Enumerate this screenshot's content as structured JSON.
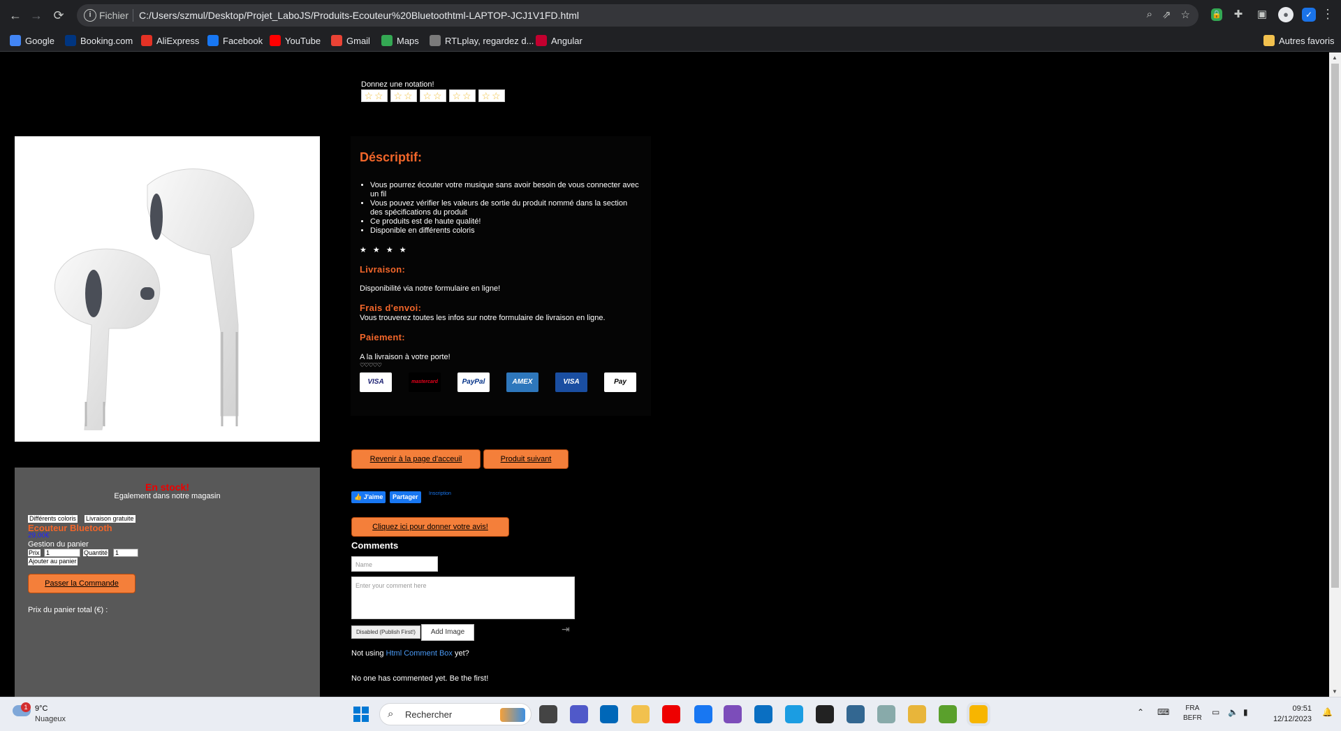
{
  "browser": {
    "scheme_label": "Fichier",
    "url": "C:/Users/szmul/Desktop/Projet_LaboJS/Produits-Ecouteur%20Bluetoothtml-LAPTOP-JCJ1V1FD.html",
    "bookmarks": [
      {
        "label": "Google",
        "icon": "google-icon",
        "color": "#4285f4"
      },
      {
        "label": "Booking.com",
        "icon": "booking-icon",
        "color": "#003580"
      },
      {
        "label": "AliExpress",
        "icon": "aliexpress-icon",
        "color": "#e43225"
      },
      {
        "label": "Facebook",
        "icon": "facebook-icon",
        "color": "#1877f2"
      },
      {
        "label": "YouTube",
        "icon": "youtube-icon",
        "color": "#ff0000"
      },
      {
        "label": "Gmail",
        "icon": "gmail-icon",
        "color": "#ea4335"
      },
      {
        "label": "Maps",
        "icon": "maps-icon",
        "color": "#34a853"
      },
      {
        "label": "RTLplay, regardez d...",
        "icon": "rtlplay-icon",
        "color": "#7a7a7a"
      },
      {
        "label": "Angular",
        "icon": "angular-icon",
        "color": "#c3002f"
      }
    ],
    "other_bookmarks": "Autres favoris"
  },
  "page": {
    "rating_prompt": "Donnez une notation!",
    "rating_stars": 5,
    "description": {
      "title": "Déscriptif:",
      "items": [
        "Vous pourrez écouter votre musique sans avoir besoin de vous connecter avec un fil",
        "Vous pouvez vérifier les valeurs de sortie du produit nommé dans la section des spécifications du produit",
        "Ce produits est de haute qualité!",
        "Disponible en différents coloris"
      ],
      "dots": "★ ★ ★ ★"
    },
    "livraison": {
      "title": "Livraison:",
      "text": "Disponibilité via notre formulaire en ligne!"
    },
    "frais": {
      "title": "Frais d'envoi:",
      "text": "Vous trouverez toutes les infos sur notre formulaire de livraison en ligne."
    },
    "paiement": {
      "title": "Paiement:",
      "text": "A la livraison à votre porte!",
      "hearts": "♡♡♡♡♡"
    },
    "cards": [
      {
        "label": "VISA",
        "bg": "#fff",
        "fg": "#1a1f71"
      },
      {
        "label": "mastercard",
        "bg": "#000",
        "fg": "#eb001b"
      },
      {
        "label": "PayPal",
        "bg": "#fff",
        "fg": "#003087"
      },
      {
        "label": "AMEX",
        "bg": "#2e77bc",
        "fg": "#fff"
      },
      {
        "label": "VISA",
        "bg": "#1a4ea1",
        "fg": "#fff"
      },
      {
        "label": "Pay",
        "bg": "#fff",
        "fg": "#000"
      }
    ],
    "buttons": {
      "home": "Revenir à la page d'acceuil",
      "next": "Produit suivant",
      "review": "Cliquez ici pour donner votre avis!",
      "order": "Passer la Commande"
    },
    "facebook": {
      "like": "J'aime",
      "share": "Partager",
      "text": "Inscription"
    },
    "stock": {
      "status": "En stock!",
      "store": "Egalement dans notre magasin",
      "tag1": "Différents coloris",
      "tag2": "Livraison gratuite",
      "name": "Ecouteur Bluetooth",
      "price": "29,00€",
      "cart_title": "Gestion du panier",
      "price_label": "Prix",
      "price_value": "1",
      "qty_label": "Quantité",
      "qty_value": "1",
      "add_cart": "Ajouter au panier",
      "total": "Prix du panier total (€) :"
    },
    "comments": {
      "title": "Comments",
      "name_placeholder": "Name",
      "comment_placeholder": "Enter your comment here",
      "disabled_btn": "Disabled (Publish First!)",
      "add_image": "Add Image",
      "not_using_pre": "Not using",
      "not_using_link": "Html Comment Box",
      "not_using_post": "yet?",
      "no_one": "No one has commented yet. Be the first!"
    }
  },
  "taskbar": {
    "weather_temp": "9°C",
    "weather_cond": "Nuageux",
    "weather_badge": "1",
    "search": "Rechercher",
    "lang1": "FRA",
    "lang2": "BEFR",
    "time": "09:51",
    "date": "12/12/2023",
    "apps": [
      {
        "name": "file-manager-icon",
        "color": "#444"
      },
      {
        "name": "teams-icon",
        "color": "#5059c9"
      },
      {
        "name": "store-icon",
        "color": "#0067b8"
      },
      {
        "name": "folder-icon",
        "color": "#f2c14e"
      },
      {
        "name": "youtube-app-icon",
        "color": "#e00"
      },
      {
        "name": "facebook-app-icon",
        "color": "#1877f2"
      },
      {
        "name": "visual-studio-icon",
        "color": "#7c4dba"
      },
      {
        "name": "vscode-icon",
        "color": "#0a6fc2"
      },
      {
        "name": "edge-icon",
        "color": "#1b9de2"
      },
      {
        "name": "terminal-icon",
        "color": "#222"
      },
      {
        "name": "postgres-icon",
        "color": "#336791"
      },
      {
        "name": "network-icon",
        "color": "#8aa"
      },
      {
        "name": "paint-icon",
        "color": "#e8b53a"
      },
      {
        "name": "notepad-icon",
        "color": "#5aa02c"
      },
      {
        "name": "chrome-icon",
        "color": "#f7b500"
      }
    ]
  }
}
